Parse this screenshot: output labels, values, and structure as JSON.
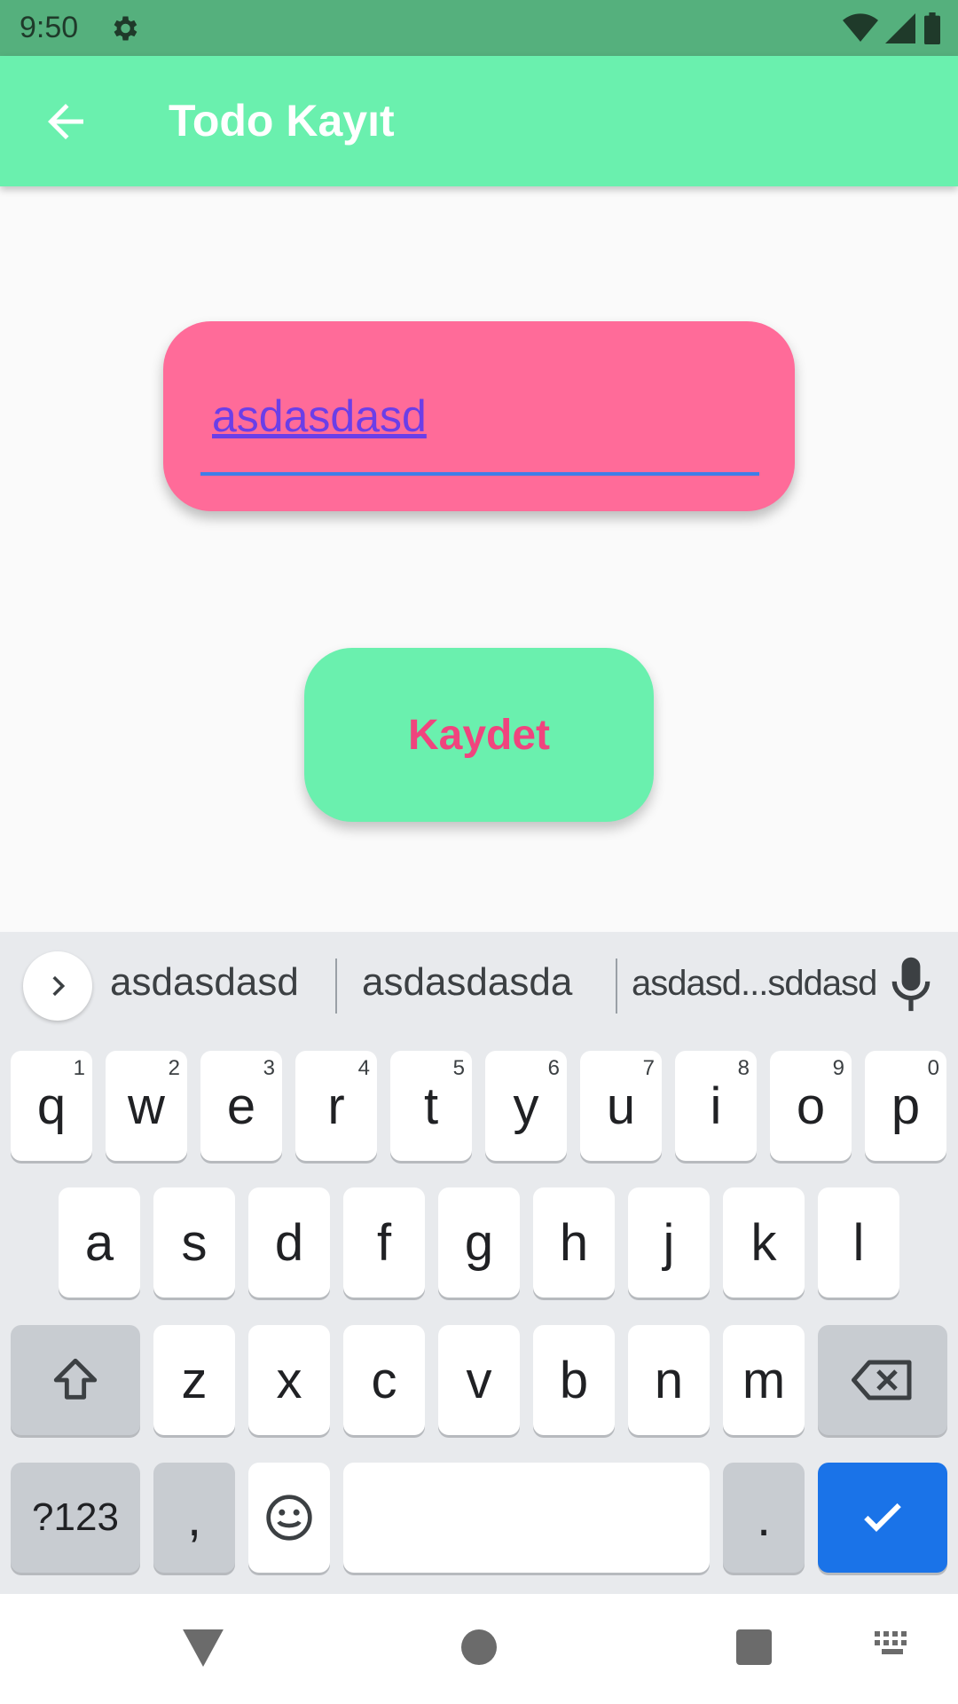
{
  "status_bar": {
    "time": "9:50"
  },
  "app_bar": {
    "title": "Todo Kayıt"
  },
  "form": {
    "input_value": "asdasdasd",
    "save_label": "Kaydet"
  },
  "keyboard": {
    "suggestions": [
      "asdasdasd",
      "asdasdasda",
      "asdasd...sddasd"
    ],
    "row1": [
      {
        "k": "q",
        "h": "1"
      },
      {
        "k": "w",
        "h": "2"
      },
      {
        "k": "e",
        "h": "3"
      },
      {
        "k": "r",
        "h": "4"
      },
      {
        "k": "t",
        "h": "5"
      },
      {
        "k": "y",
        "h": "6"
      },
      {
        "k": "u",
        "h": "7"
      },
      {
        "k": "i",
        "h": "8"
      },
      {
        "k": "o",
        "h": "9"
      },
      {
        "k": "p",
        "h": "0"
      }
    ],
    "row2": [
      "a",
      "s",
      "d",
      "f",
      "g",
      "h",
      "j",
      "k",
      "l"
    ],
    "row3": [
      "z",
      "x",
      "c",
      "v",
      "b",
      "n",
      "m"
    ],
    "symbols_label": "?123",
    "comma": ",",
    "period": "."
  },
  "colors": {
    "app_bar": "#6af0ae",
    "status_bar": "#55b07d",
    "card": "#ff6b99",
    "save_text": "#f0447e",
    "enter_key": "#1a73e8"
  }
}
